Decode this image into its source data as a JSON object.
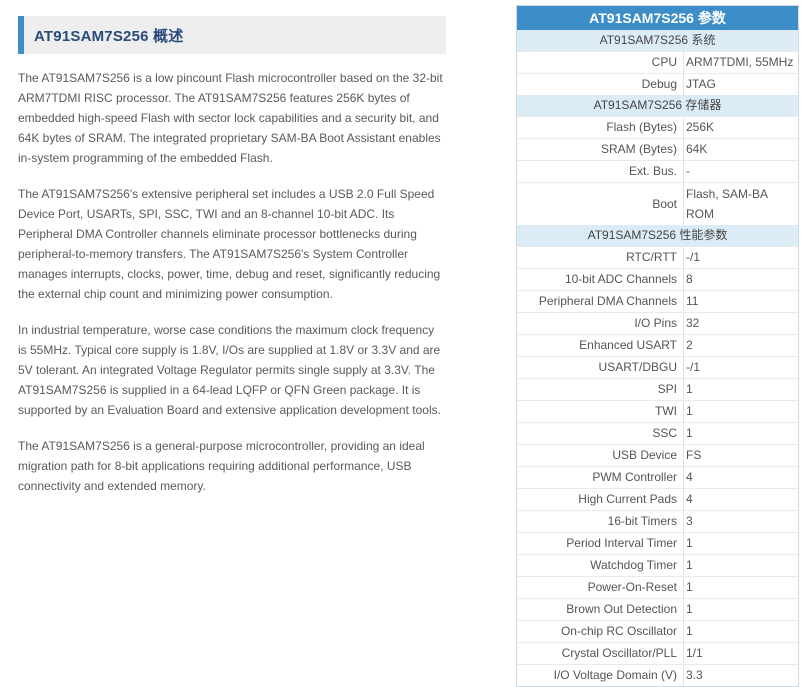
{
  "article": {
    "title": "AT91SAM7S256 概述",
    "paragraphs": [
      "The AT91SAM7S256 is a low pincount Flash microcontroller based on the 32-bit ARM7TDMI RISC processor. The AT91SAM7S256 features 256K bytes of embedded high-speed Flash with sector lock capabilities and a security bit, and 64K bytes of SRAM. The integrated proprietary SAM-BA Boot Assistant enables in-system programming of the embedded Flash.",
      "The AT91SAM7S256's extensive peripheral set includes a USB 2.0 Full Speed Device Port, USARTs, SPI, SSC, TWI and an 8-channel 10-bit ADC. Its Peripheral DMA Controller channels eliminate processor bottlenecks during peripheral-to-memory transfers. The AT91SAM7S256's System Controller manages interrupts, clocks, power, time, debug and reset, significantly reducing the external chip count and minimizing power consumption.",
      "In industrial temperature, worse case conditions the maximum clock frequency is 55MHz. Typical core supply is 1.8V, I/Os are supplied at 1.8V or 3.3V and are 5V tolerant. An integrated Voltage Regulator permits single supply at 3.3V. The AT91SAM7S256 is supplied in a 64-lead LQFP or QFN Green package. It is supported by an Evaluation Board and extensive application development tools.",
      "The AT91SAM7S256 is a general-purpose microcontroller, providing an ideal migration path for 8-bit applications requiring additional performance, USB connectivity and extended memory."
    ]
  },
  "spec": {
    "title": "AT91SAM7S256 参数",
    "sections": [
      {
        "label": "AT91SAM7S256 系统",
        "rows": [
          {
            "k": "CPU",
            "v": "ARM7TDMI, 55MHz"
          },
          {
            "k": "Debug",
            "v": "JTAG"
          }
        ]
      },
      {
        "label": "AT91SAM7S256 存储器",
        "rows": [
          {
            "k": "Flash (Bytes)",
            "v": "256K"
          },
          {
            "k": "SRAM (Bytes)",
            "v": "64K"
          },
          {
            "k": "Ext. Bus.",
            "v": "-"
          },
          {
            "k": "Boot",
            "v": "Flash, SAM-BA ROM"
          }
        ]
      },
      {
        "label": "AT91SAM7S256 性能参数",
        "rows": [
          {
            "k": "RTC/RTT",
            "v": "-/1"
          },
          {
            "k": "10-bit ADC Channels",
            "v": "8"
          },
          {
            "k": "Peripheral DMA Channels",
            "v": "11"
          },
          {
            "k": "I/O Pins",
            "v": "32"
          },
          {
            "k": "Enhanced USART",
            "v": "2"
          },
          {
            "k": "USART/DBGU",
            "v": "-/1"
          },
          {
            "k": "SPI",
            "v": "1"
          },
          {
            "k": "TWI",
            "v": "1"
          },
          {
            "k": "SSC",
            "v": "1"
          },
          {
            "k": "USB Device",
            "v": "FS"
          },
          {
            "k": "PWM Controller",
            "v": "4"
          },
          {
            "k": "High Current Pads",
            "v": "4"
          },
          {
            "k": "16-bit Timers",
            "v": "3"
          },
          {
            "k": "Period Interval Timer",
            "v": "1"
          },
          {
            "k": "Watchdog Timer",
            "v": "1"
          },
          {
            "k": "Power-On-Reset",
            "v": "1"
          },
          {
            "k": "Brown Out Detection",
            "v": "1"
          },
          {
            "k": "On-chip RC Oscillator",
            "v": "1"
          },
          {
            "k": "Crystal Oscillator/PLL",
            "v": "1/1"
          },
          {
            "k": "I/O Voltage Domain (V)",
            "v": "3.3"
          }
        ]
      }
    ]
  },
  "colors": {
    "accent": "#3d8ec8",
    "section_bg": "#dcecf7",
    "heading_text": "#2a4a7a"
  }
}
